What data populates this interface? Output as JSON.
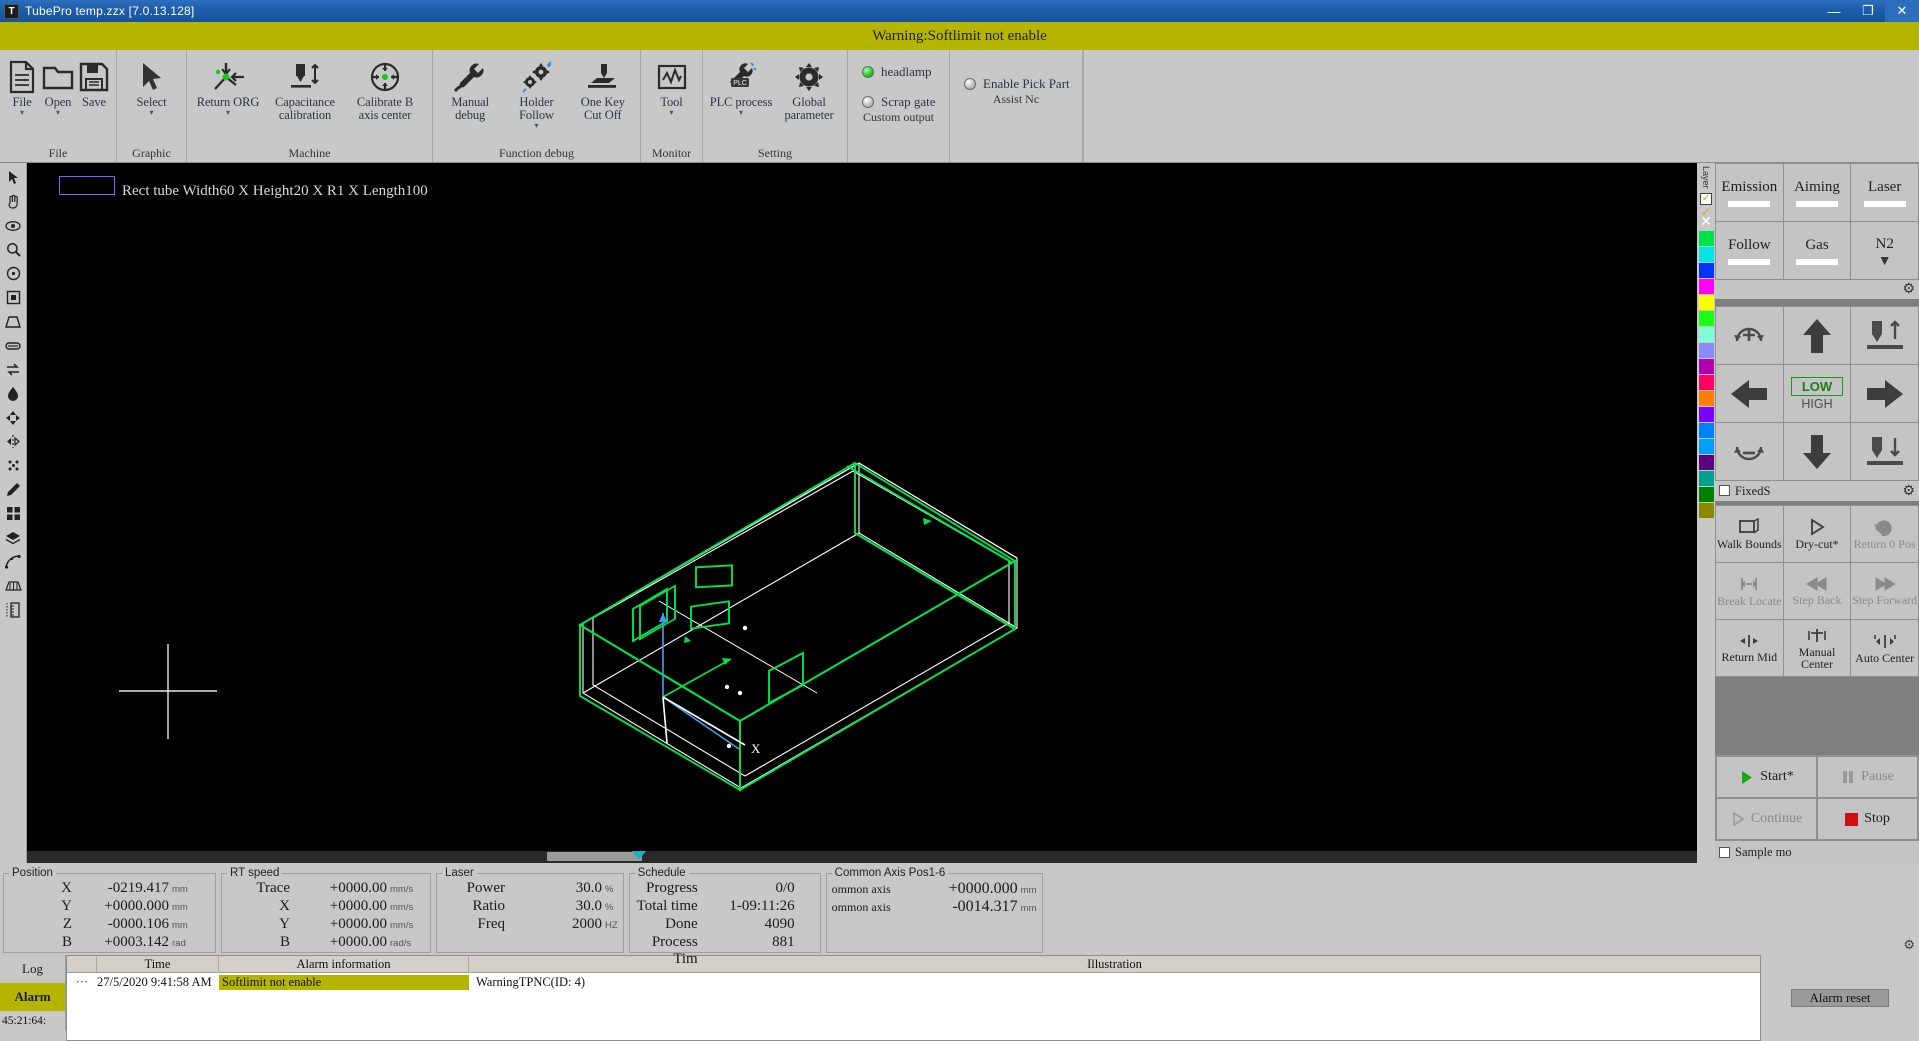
{
  "window": {
    "icon": "app-icon",
    "title": "TubePro temp.zzx  [7.0.13.128]",
    "minimize": "—",
    "maximize": "❐",
    "close": "✕"
  },
  "warning": {
    "text": "Warning:Softlimit not enable"
  },
  "ribbon": {
    "groups": [
      {
        "label": "File",
        "items": [
          {
            "name": "file",
            "label": "File",
            "icon": "document-icon",
            "caret": true
          },
          {
            "name": "open",
            "label": "Open",
            "icon": "folder-icon",
            "caret": true
          },
          {
            "name": "save",
            "label": "Save",
            "icon": "floppy-disk-icon",
            "caret": false
          }
        ]
      },
      {
        "label": "Graphic",
        "items": [
          {
            "name": "select",
            "label": "Select",
            "icon": "cursor-arrow-icon",
            "caret": true
          }
        ]
      },
      {
        "label": "Machine",
        "items": [
          {
            "name": "return-org",
            "label": "Return ORG",
            "icon": "return-origin-icon",
            "caret": true
          },
          {
            "name": "capacitance-calibration",
            "label": "Capacitance calibration",
            "icon": "capacitance-icon",
            "caret": false
          },
          {
            "name": "calibrate-b-axis-center",
            "label": "Calibrate B axis center",
            "icon": "b-axis-center-icon",
            "caret": false
          }
        ]
      },
      {
        "label": "Function debug",
        "items": [
          {
            "name": "manual-debug",
            "label": "Manual debug",
            "icon": "wrench-hammer-icon",
            "caret": false
          },
          {
            "name": "holder-follow",
            "label": "Holder Follow",
            "icon": "gears-icon",
            "caret": true
          },
          {
            "name": "one-key-cut-off",
            "label": "One Key Cut Off",
            "icon": "cut-off-icon",
            "caret": false
          }
        ]
      },
      {
        "label": "Monitor",
        "items": [
          {
            "name": "tool",
            "label": "Tool",
            "icon": "waveform-icon",
            "caret": true
          }
        ]
      },
      {
        "label": "Setting",
        "items": [
          {
            "name": "plc-process",
            "label": "PLC process",
            "icon": "plc-icon",
            "caret": true
          },
          {
            "name": "global-parameter",
            "label": "Global parameter",
            "icon": "gear-icon",
            "caret": false
          }
        ]
      },
      {
        "label": "Custom output",
        "items": []
      },
      {
        "label": "Assist Nc",
        "items": []
      }
    ],
    "custom_output": [
      {
        "name": "headlamp",
        "label": "headlamp",
        "state": "on"
      },
      {
        "name": "scrap-gate",
        "label": "Scrap gate",
        "state": "off"
      }
    ],
    "assist_nc": [
      {
        "name": "enable-pick-part",
        "label": "Enable Pick Part",
        "state": "off"
      }
    ]
  },
  "left_tools": [
    {
      "name": "pointer-tool",
      "icon": "cursor-arrow-icon"
    },
    {
      "name": "pan-tool",
      "icon": "hand-icon"
    },
    {
      "name": "visibility-tool",
      "icon": "eye-icon"
    },
    {
      "name": "zoom-tool",
      "icon": "magnifier-icon"
    },
    {
      "name": "circle-tool",
      "icon": "circle-icon"
    },
    {
      "name": "rectangle-tool",
      "icon": "square-icon"
    },
    {
      "name": "trapezoid-tool",
      "icon": "trapezoid-icon"
    },
    {
      "name": "slot-tool",
      "icon": "slot-icon"
    },
    {
      "name": "flip-tool",
      "icon": "flip-arrows-icon"
    },
    {
      "name": "point-tool",
      "icon": "teardrop-icon"
    },
    {
      "name": "array-tool",
      "icon": "diamond-arrows-icon"
    },
    {
      "name": "mirror-tool",
      "icon": "mirror-icon"
    },
    {
      "name": "scatter-tool",
      "icon": "dots-icon"
    },
    {
      "name": "eyedropper-tool",
      "icon": "pen-icon"
    },
    {
      "name": "grid-tool",
      "icon": "grid-icon"
    },
    {
      "name": "layer-tool",
      "icon": "layers-icon"
    },
    {
      "name": "curve-tool",
      "icon": "curve-icon"
    },
    {
      "name": "bridge-tool",
      "icon": "bridge-icon"
    },
    {
      "name": "ruler-tool",
      "icon": "ruler-icon"
    }
  ],
  "canvas": {
    "part_label": "Rect tube Width60 X Height20 X R1 X Length100",
    "tube": {
      "width": 60,
      "height": 20,
      "corner_radius": 1,
      "length": 100
    },
    "colors": {
      "outline": "#00e24a",
      "wireframe": "#ffffff",
      "axis_x": "#28b4ff",
      "axis_y": "#00e24a",
      "axis_z": "#ffffff"
    }
  },
  "palette": {
    "header": "Layer",
    "checkbox_checked": true,
    "swatches": [
      "#00e24a",
      "#00e6e6",
      "#0033ff",
      "#ff00ff",
      "#ffff00",
      "#1aff1a",
      "#7fffd4",
      "#8b8bff",
      "#b000b0",
      "#ff0060",
      "#ff7f00",
      "#7a00ff",
      "#0080ff",
      "#00a0ff",
      "#5a0080",
      "#00a08c",
      "#008000",
      "#8a8a00"
    ]
  },
  "right_panel": {
    "toggles": [
      {
        "name": "emission",
        "label": "Emission",
        "indicator": "bar"
      },
      {
        "name": "aiming",
        "label": "Aiming",
        "indicator": "bar"
      },
      {
        "name": "laser",
        "label": "Laser",
        "indicator": "bar"
      },
      {
        "name": "follow",
        "label": "Follow",
        "indicator": "bar"
      },
      {
        "name": "gas",
        "label": "Gas",
        "indicator": "bar"
      },
      {
        "name": "n2",
        "label": "N2",
        "indicator": "dropdown"
      }
    ],
    "jog": [
      {
        "name": "rotate-cw",
        "icon": "rotate-plus-icon"
      },
      {
        "name": "jog-up",
        "icon": "arrow-up-icon"
      },
      {
        "name": "nozzle-up",
        "icon": "nozzle-up-icon"
      },
      {
        "name": "jog-left",
        "icon": "arrow-left-icon"
      },
      {
        "name": "speed-toggle",
        "icon": "speed-toggle",
        "low": "LOW",
        "high": "HIGH",
        "selected": "LOW"
      },
      {
        "name": "jog-right",
        "icon": "arrow-right-icon"
      },
      {
        "name": "rotate-ccw",
        "icon": "rotate-minus-icon"
      },
      {
        "name": "jog-down",
        "icon": "arrow-down-icon"
      },
      {
        "name": "nozzle-down",
        "icon": "nozzle-down-icon"
      }
    ],
    "fixed_label": "FixedS",
    "actions": [
      {
        "name": "walk-bounds",
        "label": "Walk Bounds",
        "icon": "bounds-icon",
        "enabled": true
      },
      {
        "name": "dry-cut",
        "label": "Dry-cut*",
        "icon": "play-outline-icon",
        "enabled": true
      },
      {
        "name": "return-o-pos",
        "label": "Return 0 Pos",
        "icon": "return-zero-icon",
        "enabled": false
      },
      {
        "name": "break-locate",
        "label": "Break Locate",
        "icon": "break-locate-icon",
        "enabled": false
      },
      {
        "name": "step-back",
        "label": "Step Back",
        "icon": "rewind-icon",
        "enabled": false
      },
      {
        "name": "step-forward",
        "label": "Step Forward",
        "icon": "forward-icon",
        "enabled": false
      },
      {
        "name": "return-mid",
        "label": "Return Mid",
        "icon": "return-mid-icon",
        "enabled": true
      },
      {
        "name": "manual-center",
        "label": "Manual Center",
        "icon": "manual-center-icon",
        "enabled": true
      },
      {
        "name": "auto-center",
        "label": "Auto Center",
        "icon": "auto-center-icon",
        "enabled": true
      }
    ],
    "run_buttons": [
      {
        "name": "start",
        "label": "Start*",
        "icon": "play-icon",
        "enabled": true
      },
      {
        "name": "pause",
        "label": "Pause",
        "icon": "pause-icon",
        "enabled": false
      },
      {
        "name": "continue",
        "label": "Continue",
        "icon": "play-outline-icon",
        "enabled": false
      },
      {
        "name": "stop",
        "label": "Stop",
        "icon": "stop-icon",
        "enabled": true
      }
    ],
    "sample_mode": {
      "label": "Sample mo",
      "checked": false
    }
  },
  "status": {
    "position": {
      "title": "Position",
      "rows": [
        {
          "name": "X",
          "value": "-0219.417",
          "unit": "mm"
        },
        {
          "name": "Y",
          "value": "+0000.000",
          "unit": "mm"
        },
        {
          "name": "Z",
          "value": "-0000.106",
          "unit": "mm"
        },
        {
          "name": "B",
          "value": "+0003.142",
          "unit": "rad"
        }
      ]
    },
    "rt_speed": {
      "title": "RT speed",
      "rows": [
        {
          "name": "Trace",
          "value": "+0000.00",
          "unit": "mm/s"
        },
        {
          "name": "X",
          "value": "+0000.00",
          "unit": "mm/s"
        },
        {
          "name": "Y",
          "value": "+0000.00",
          "unit": "mm/s"
        },
        {
          "name": "B",
          "value": "+0000.00",
          "unit": "rad/s"
        }
      ]
    },
    "laser": {
      "title": "Laser",
      "rows": [
        {
          "name": "Power",
          "value": "30.0",
          "unit": "%"
        },
        {
          "name": "Ratio",
          "value": "30.0",
          "unit": "%"
        },
        {
          "name": "Freq",
          "value": "2000",
          "unit": "HZ"
        }
      ]
    },
    "schedule": {
      "title": "Schedule",
      "rows": [
        {
          "name": "Progress",
          "value": "0/0",
          "unit": ""
        },
        {
          "name": "Total time",
          "value": "1-09:11:26",
          "unit": ""
        },
        {
          "name": "Done",
          "value": "4090",
          "unit": ""
        },
        {
          "name": "Process Tim",
          "value": "881",
          "unit": ""
        }
      ]
    },
    "common_axis": {
      "title": "Common Axis Pos1-6",
      "rows": [
        {
          "name": "ommon axis",
          "value": "+0000.000",
          "unit": "mm"
        },
        {
          "name": "ommon axis",
          "value": "-0014.317",
          "unit": "mm"
        }
      ]
    }
  },
  "log": {
    "tabs": [
      {
        "name": "log-tab",
        "label": "Log",
        "selected": false
      },
      {
        "name": "alarm-tab",
        "label": "Alarm",
        "selected": true
      }
    ],
    "side_time": "45:21:64:",
    "headers": [
      "",
      "Time",
      "Alarm information",
      "Illustration"
    ],
    "rows": [
      {
        "marker": "···",
        "time": "27/5/2020 9:41:58 AM",
        "alarm": "Softlimit not enable",
        "illustration": "WarningTPNC(ID: 4)"
      }
    ],
    "reset_button": "Alarm reset"
  }
}
